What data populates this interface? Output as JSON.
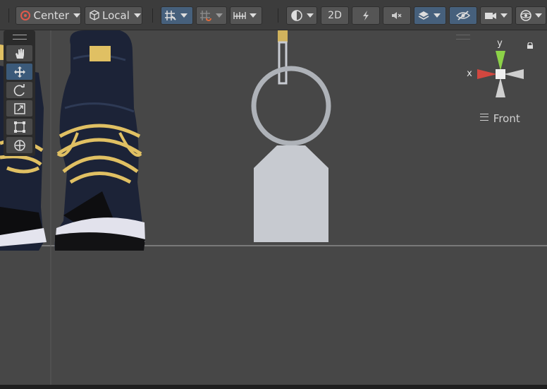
{
  "toolbar": {
    "pivot_mode_label": "Center",
    "pivot_rotation_label": "Local",
    "mode_2d_label": "2D"
  },
  "tools": [
    "view-tool",
    "move-tool",
    "rotate-tool",
    "scale-tool",
    "rect-tool",
    "transform-tool"
  ],
  "active_tool": "move-tool",
  "gizmo": {
    "y_label": "y",
    "x_label": "x",
    "view_label": "Front",
    "colors": {
      "y": "#8cd248",
      "x": "#d2473f",
      "neutral": "#cfcfcf"
    }
  },
  "scene": {
    "shoe_color": "#1c2337",
    "lace_color": "#e0c063",
    "sole_color": "#e2e2ec",
    "tag_color": "#c7cad0"
  }
}
